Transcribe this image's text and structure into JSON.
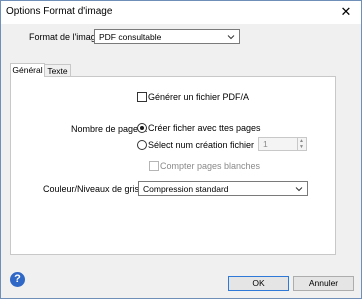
{
  "window": {
    "title": "Options Format d'image",
    "close_glyph": "✕"
  },
  "format": {
    "label": "Format de l'image :",
    "value": "PDF consultable"
  },
  "tabs": [
    {
      "label": "Général",
      "active": true
    },
    {
      "label": "Texte",
      "active": false
    }
  ],
  "general": {
    "pdfa_checkbox": {
      "label": "Générer un fichier PDF/A",
      "checked": false
    },
    "pages_label": "Nombre de pages :",
    "radio_all": {
      "label": "Créer ficher avec ttes pages",
      "selected": true
    },
    "radio_select": {
      "label": "Sélect num création fichier",
      "selected": false
    },
    "spinner_value": "1",
    "count_blank": {
      "label": "Compter pages blanches",
      "checked": false,
      "enabled": false
    },
    "color_label": "Couleur/Niveaux de gris :",
    "color_value": "Compression standard"
  },
  "buttons": {
    "help_glyph": "?",
    "ok": "OK",
    "cancel": "Annuler"
  },
  "icons": {
    "close": "close-icon",
    "chevron": "chevron-down-icon",
    "help": "help-icon"
  }
}
